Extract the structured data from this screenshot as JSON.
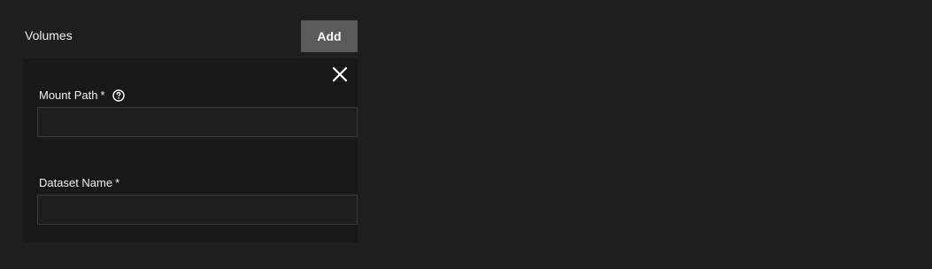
{
  "volumes": {
    "label": "Volumes",
    "add_label": "Add"
  },
  "volume_item": {
    "close_icon": "close-icon",
    "mount_path": {
      "label": "Mount Path",
      "required_marker": "*",
      "help_icon": "help-circle-icon",
      "value": "",
      "placeholder": ""
    },
    "dataset_name": {
      "label": "Dataset Name",
      "required_marker": "*",
      "value": "",
      "placeholder": ""
    }
  },
  "colors": {
    "background": "#1e1e1e",
    "card_background": "#181818",
    "button_background": "#5a5a5a",
    "input_border": "#3a3a3a",
    "text": "#f0f0f0"
  }
}
